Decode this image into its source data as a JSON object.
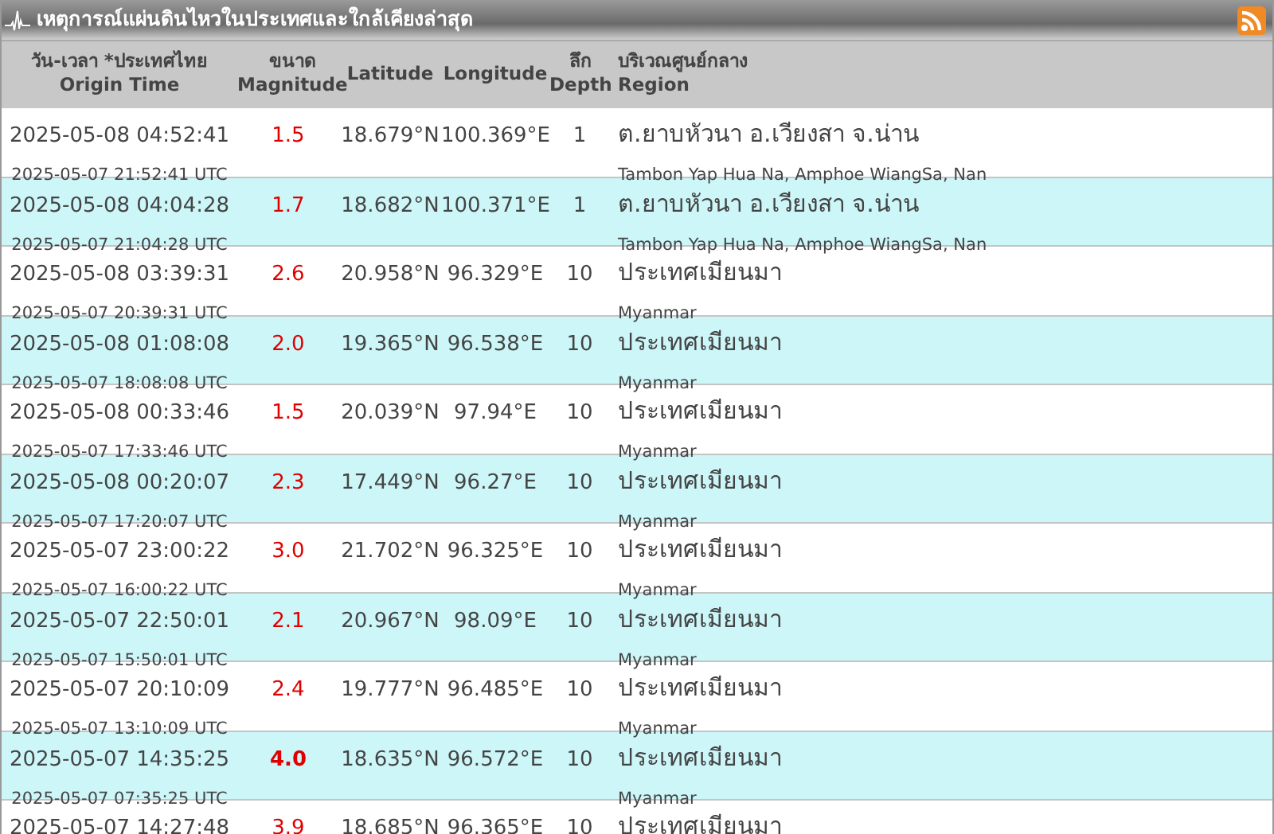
{
  "title": "เหตุการณ์แผ่นดินไหวในประเทศและใกล้เคียงล่าสุด",
  "columns": [
    {
      "thai": "วัน-เวลา *ประเทศไทย",
      "english": "Origin Time"
    },
    {
      "thai": "ขนาด",
      "english": "Magnitude"
    },
    {
      "english": "Latitude"
    },
    {
      "english": "Longitude"
    },
    {
      "thai": "ลึก",
      "english": "Depth"
    },
    {
      "thai": "บริเวณศูนย์กลาง",
      "english": "Region"
    }
  ],
  "rows": [
    {
      "time": "2025-05-08 04:52:41",
      "utc": "2025-05-07 21:52:41 UTC",
      "magnitude": "1.5",
      "strong": false,
      "latitude": "18.679°N",
      "longitude": "100.369°E",
      "depth": "1",
      "region_thai": "ต.ยาบหัวนา อ.เวียงสา จ.น่าน",
      "region_english": "Tambon Yap Hua Na, Amphoe WiangSa, Nan"
    },
    {
      "time": "2025-05-08 04:04:28",
      "utc": "2025-05-07 21:04:28 UTC",
      "magnitude": "1.7",
      "strong": false,
      "latitude": "18.682°N",
      "longitude": "100.371°E",
      "depth": "1",
      "region_thai": "ต.ยาบหัวนา อ.เวียงสา จ.น่าน",
      "region_english": "Tambon Yap Hua Na, Amphoe WiangSa, Nan"
    },
    {
      "time": "2025-05-08 03:39:31",
      "utc": "2025-05-07 20:39:31 UTC",
      "magnitude": "2.6",
      "strong": false,
      "latitude": "20.958°N",
      "longitude": "96.329°E",
      "depth": "10",
      "region_thai": "ประเทศเมียนมา",
      "region_english": "Myanmar"
    },
    {
      "time": "2025-05-08 01:08:08",
      "utc": "2025-05-07 18:08:08 UTC",
      "magnitude": "2.0",
      "strong": false,
      "latitude": "19.365°N",
      "longitude": "96.538°E",
      "depth": "10",
      "region_thai": "ประเทศเมียนมา",
      "region_english": "Myanmar"
    },
    {
      "time": "2025-05-08 00:33:46",
      "utc": "2025-05-07 17:33:46 UTC",
      "magnitude": "1.5",
      "strong": false,
      "latitude": "20.039°N",
      "longitude": "97.94°E",
      "depth": "10",
      "region_thai": "ประเทศเมียนมา",
      "region_english": "Myanmar"
    },
    {
      "time": "2025-05-08 00:20:07",
      "utc": "2025-05-07 17:20:07 UTC",
      "magnitude": "2.3",
      "strong": false,
      "latitude": "17.449°N",
      "longitude": "96.27°E",
      "depth": "10",
      "region_thai": "ประเทศเมียนมา",
      "region_english": "Myanmar"
    },
    {
      "time": "2025-05-07 23:00:22",
      "utc": "2025-05-07 16:00:22 UTC",
      "magnitude": "3.0",
      "strong": false,
      "latitude": "21.702°N",
      "longitude": "96.325°E",
      "depth": "10",
      "region_thai": "ประเทศเมียนมา",
      "region_english": "Myanmar"
    },
    {
      "time": "2025-05-07 22:50:01",
      "utc": "2025-05-07 15:50:01 UTC",
      "magnitude": "2.1",
      "strong": false,
      "latitude": "20.967°N",
      "longitude": "98.09°E",
      "depth": "10",
      "region_thai": "ประเทศเมียนมา",
      "region_english": "Myanmar"
    },
    {
      "time": "2025-05-07 20:10:09",
      "utc": "2025-05-07 13:10:09 UTC",
      "magnitude": "2.4",
      "strong": false,
      "latitude": "19.777°N",
      "longitude": "96.485°E",
      "depth": "10",
      "region_thai": "ประเทศเมียนมา",
      "region_english": "Myanmar"
    },
    {
      "time": "2025-05-07 14:35:25",
      "utc": "2025-05-07 07:35:25 UTC",
      "magnitude": "4.0",
      "strong": true,
      "latitude": "18.635°N",
      "longitude": "96.572°E",
      "depth": "10",
      "region_thai": "ประเทศเมียนมา",
      "region_english": "Myanmar"
    },
    {
      "time": "2025-05-07 14:27:48",
      "magnitude": "3.9",
      "strong": false,
      "latitude": "18.685°N",
      "longitude": "96.365°E",
      "depth": "10",
      "region_thai": "ประเทศเมียนมา"
    }
  ]
}
